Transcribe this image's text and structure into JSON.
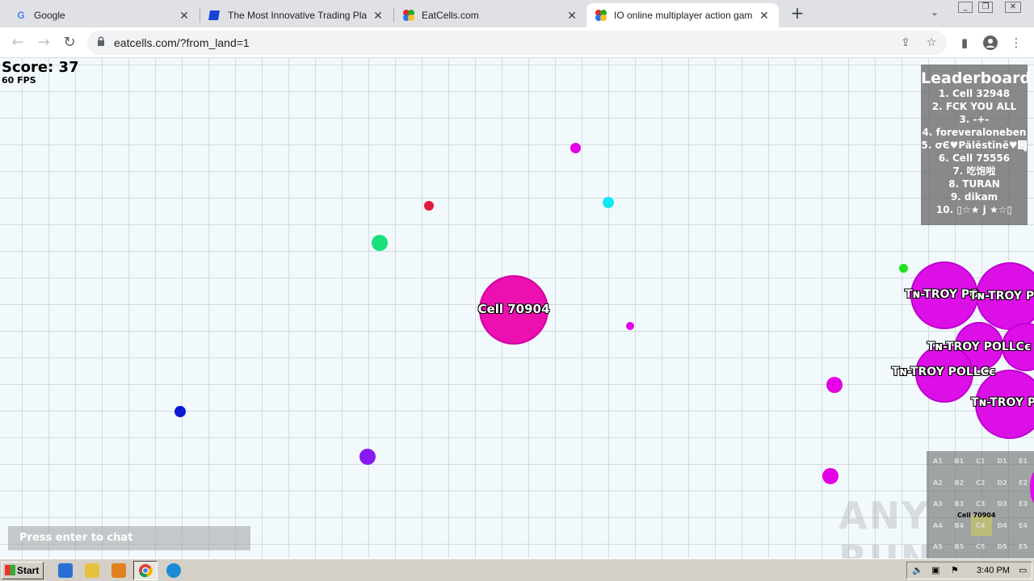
{
  "browser": {
    "tabs": [
      {
        "title": "Google",
        "icon": "google-icon",
        "active": false
      },
      {
        "title": "The Most Innovative Trading Platform",
        "icon": "trading-platform-icon",
        "active": false
      },
      {
        "title": "EatCells.com",
        "icon": "eatcells-icon",
        "active": false
      },
      {
        "title": "IO online multiplayer action game. S",
        "icon": "eatcells-icon",
        "active": true
      }
    ],
    "url": "eatcells.com/?from_land=1"
  },
  "game": {
    "score_label": "Score: 37",
    "fps_label": "60 FPS",
    "player_cell": "Cell 70904",
    "enemy_name": "Tɴ-TROY POLLCє",
    "enemy_name_short": "Tɴ-TROY PO",
    "enemy_name_mid": "Tɴ-TROY POLLCє",
    "chat_placeholder": "Press enter to chat",
    "leaderboard": {
      "title": "Leaderboard",
      "entries": [
        "1. Cell 32948",
        "2. FCK YOU ALL",
        "3. -+-",
        "4. foreveraloneben",
        "5. σЄ♥Pälëstïnë♥฻ู",
        "6. Cell 75556",
        "7. 吃饱啦",
        "8. TURAN",
        "9. dikam",
        "10. ▯☆★ j ★☆▯"
      ]
    },
    "minimap": {
      "cols": [
        "A",
        "B",
        "C",
        "D",
        "E"
      ],
      "rows": [
        "1",
        "2",
        "3",
        "4",
        "5"
      ],
      "player_label": "Cell 70904"
    }
  },
  "taskbar": {
    "start_label": "Start",
    "clock": "3:40 PM"
  },
  "watermark": "ANY RUN"
}
